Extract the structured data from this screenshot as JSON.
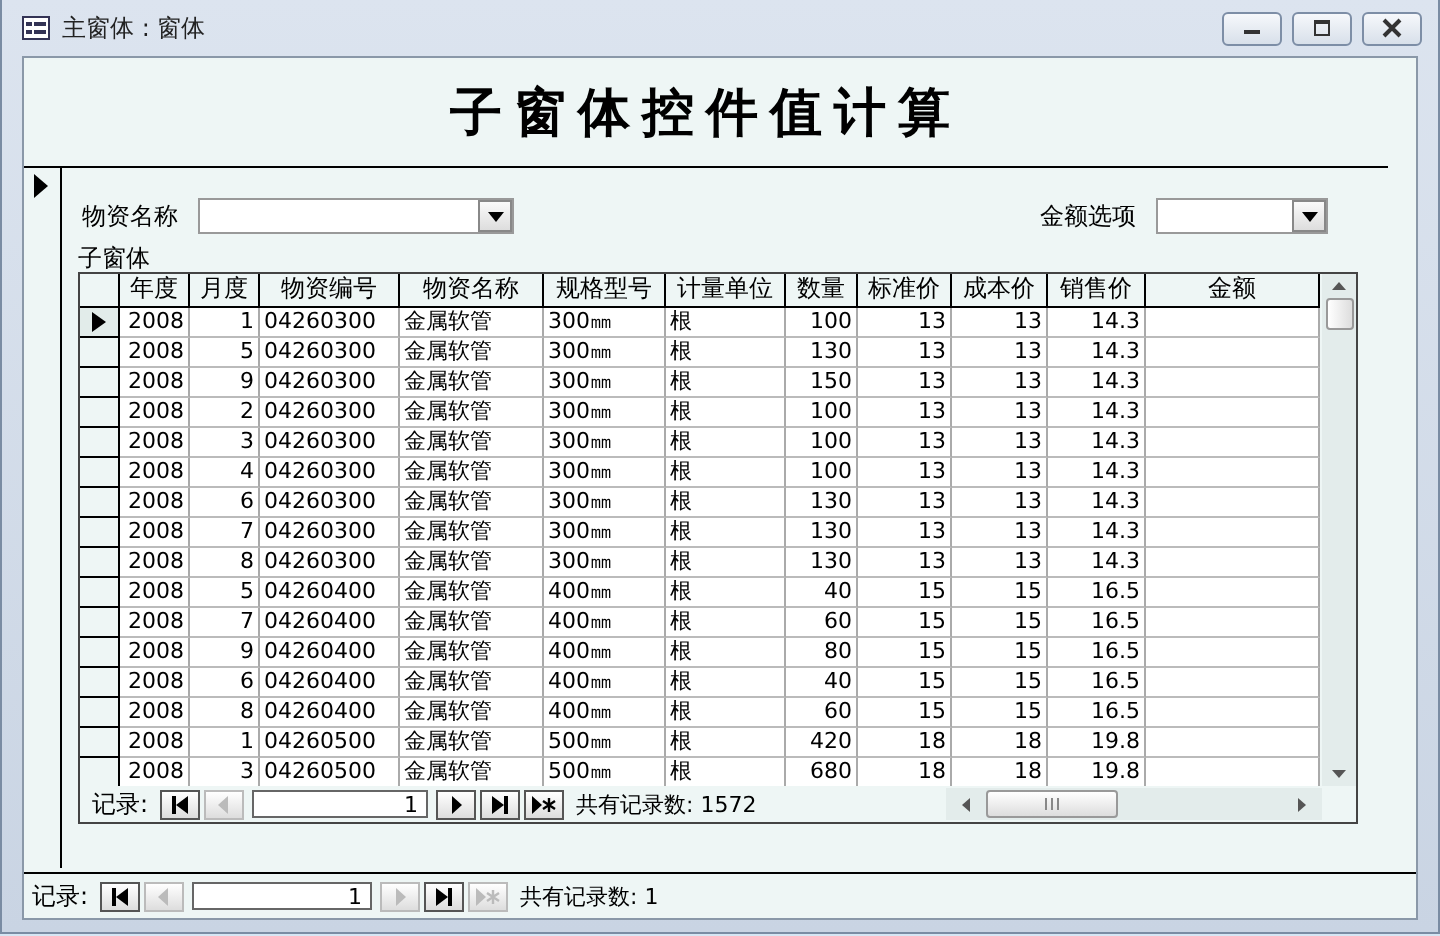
{
  "window": {
    "title": "主窗体 : 窗体"
  },
  "header": {
    "title": "子窗体控件值计算"
  },
  "filters": [
    {
      "label": "物资名称",
      "kind": "combo"
    },
    {
      "label": "金额选项",
      "kind": "combo"
    }
  ],
  "subform": {
    "label": "子窗体",
    "columns": [
      "年度",
      "月度",
      "物资编号",
      "物资名称",
      "规格型号",
      "计量单位",
      "数量",
      "标准价",
      "成本价",
      "销售价",
      "金额"
    ],
    "rows": [
      {
        "selected": true,
        "cells": [
          "2008",
          "1",
          "04260300",
          "金属软管",
          "300㎜",
          "根",
          "100",
          "13",
          "13",
          "14.3",
          ""
        ]
      },
      {
        "selected": false,
        "cells": [
          "2008",
          "5",
          "04260300",
          "金属软管",
          "300㎜",
          "根",
          "130",
          "13",
          "13",
          "14.3",
          ""
        ]
      },
      {
        "selected": false,
        "cells": [
          "2008",
          "9",
          "04260300",
          "金属软管",
          "300㎜",
          "根",
          "150",
          "13",
          "13",
          "14.3",
          ""
        ]
      },
      {
        "selected": false,
        "cells": [
          "2008",
          "2",
          "04260300",
          "金属软管",
          "300㎜",
          "根",
          "100",
          "13",
          "13",
          "14.3",
          ""
        ]
      },
      {
        "selected": false,
        "cells": [
          "2008",
          "3",
          "04260300",
          "金属软管",
          "300㎜",
          "根",
          "100",
          "13",
          "13",
          "14.3",
          ""
        ]
      },
      {
        "selected": false,
        "cells": [
          "2008",
          "4",
          "04260300",
          "金属软管",
          "300㎜",
          "根",
          "100",
          "13",
          "13",
          "14.3",
          ""
        ]
      },
      {
        "selected": false,
        "cells": [
          "2008",
          "6",
          "04260300",
          "金属软管",
          "300㎜",
          "根",
          "130",
          "13",
          "13",
          "14.3",
          ""
        ]
      },
      {
        "selected": false,
        "cells": [
          "2008",
          "7",
          "04260300",
          "金属软管",
          "300㎜",
          "根",
          "130",
          "13",
          "13",
          "14.3",
          ""
        ]
      },
      {
        "selected": false,
        "cells": [
          "2008",
          "8",
          "04260300",
          "金属软管",
          "300㎜",
          "根",
          "130",
          "13",
          "13",
          "14.3",
          ""
        ]
      },
      {
        "selected": false,
        "cells": [
          "2008",
          "5",
          "04260400",
          "金属软管",
          "400㎜",
          "根",
          "40",
          "15",
          "15",
          "16.5",
          ""
        ]
      },
      {
        "selected": false,
        "cells": [
          "2008",
          "7",
          "04260400",
          "金属软管",
          "400㎜",
          "根",
          "60",
          "15",
          "15",
          "16.5",
          ""
        ]
      },
      {
        "selected": false,
        "cells": [
          "2008",
          "9",
          "04260400",
          "金属软管",
          "400㎜",
          "根",
          "80",
          "15",
          "15",
          "16.5",
          ""
        ]
      },
      {
        "selected": false,
        "cells": [
          "2008",
          "6",
          "04260400",
          "金属软管",
          "400㎜",
          "根",
          "40",
          "15",
          "15",
          "16.5",
          ""
        ]
      },
      {
        "selected": false,
        "cells": [
          "2008",
          "8",
          "04260400",
          "金属软管",
          "400㎜",
          "根",
          "60",
          "15",
          "15",
          "16.5",
          ""
        ]
      },
      {
        "selected": false,
        "cells": [
          "2008",
          "1",
          "04260500",
          "金属软管",
          "500㎜",
          "根",
          "420",
          "18",
          "18",
          "19.8",
          ""
        ]
      },
      {
        "selected": false,
        "cells": [
          "2008",
          "3",
          "04260500",
          "金属软管",
          "500㎜",
          "根",
          "680",
          "18",
          "18",
          "19.8",
          ""
        ]
      }
    ],
    "navigator": {
      "label": "记录:",
      "current": "1",
      "total": "共有记录数: 1572",
      "buttons": [
        {
          "kind": "first",
          "disabled": false
        },
        {
          "kind": "prev",
          "disabled": true
        },
        {
          "kind": "next",
          "disabled": false
        },
        {
          "kind": "last",
          "disabled": false
        },
        {
          "kind": "new",
          "disabled": false
        }
      ]
    }
  },
  "navigator": {
    "label": "记录:",
    "current": "1",
    "total": "共有记录数: 1",
    "buttons": [
      {
        "kind": "first",
        "disabled": false
      },
      {
        "kind": "prev",
        "disabled": true
      },
      {
        "kind": "next",
        "disabled": true
      },
      {
        "kind": "last",
        "disabled": false
      },
      {
        "kind": "new",
        "disabled": true
      }
    ]
  }
}
